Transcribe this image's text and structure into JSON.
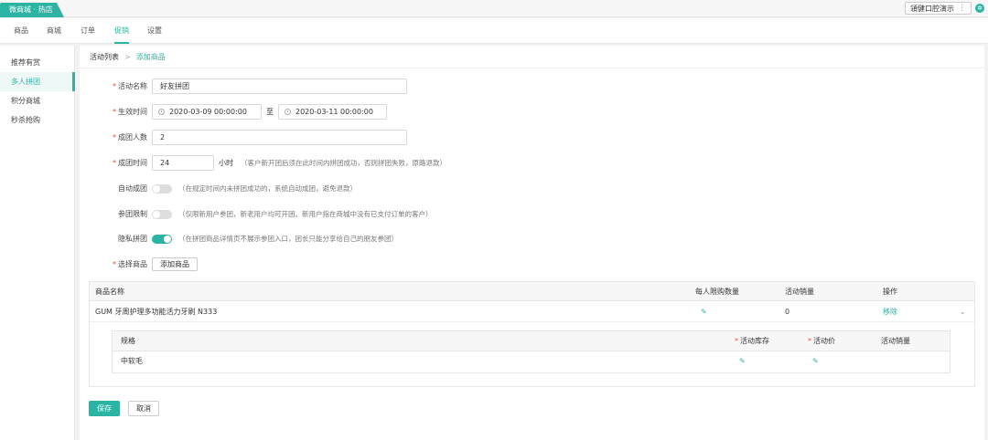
{
  "app": {
    "tab_title": "微商城 · 热店",
    "store_button": "領健口腔演示"
  },
  "nav": {
    "items": [
      "商品",
      "商城",
      "订单",
      "促销",
      "设置"
    ],
    "active": "促销"
  },
  "sidebar": {
    "items": [
      "推荐有赏",
      "多人拼团",
      "积分商城",
      "秒杀抢购"
    ],
    "active": "多人拼团"
  },
  "breadcrumb": {
    "parent": "活动列表",
    "separator": ">",
    "current": "添加商品"
  },
  "form": {
    "name": {
      "label": "活动名称",
      "value": "好友拼团"
    },
    "effective": {
      "label": "生效时间",
      "start": "2020-03-09 00:00:00",
      "to": "至",
      "end": "2020-03-11 00:00:00"
    },
    "group_size": {
      "label": "成团人数",
      "value": "2"
    },
    "group_time": {
      "label": "成团时间",
      "value": "24",
      "unit": "小时",
      "hint": "（客户新开团后须在此时间内拼团成功，否则拼团失败，原路退款）"
    },
    "auto_group": {
      "label": "自动成团",
      "on": false,
      "hint": "（在规定时间内未拼团成功的，系统自动成团，避免退款）"
    },
    "limit": {
      "label": "参团限制",
      "on": false,
      "hint": "（仅限新用户参团，新老用户均可开团。新用户指在商城中没有已支付订单的客户）"
    },
    "private": {
      "label": "隐私拼团",
      "on": true,
      "hint": "（在拼团商品详情页不展示参团入口，团长只能分享给自己的朋友参团）"
    },
    "select_goods": {
      "label": "选择商品",
      "button": "添加商品"
    }
  },
  "goods_table": {
    "headers": {
      "name": "商品名称",
      "limit": "每人限购数量",
      "sales": "活动销量",
      "op": "操作"
    },
    "rows": [
      {
        "name": "GUM 牙周护理多功能活力牙刷 N333",
        "sales": "0",
        "op": "移除"
      }
    ],
    "sub_headers": {
      "spec": "规格",
      "stock": "活动库存",
      "price": "活动价",
      "sales": "活动销量"
    },
    "sub_rows": [
      {
        "spec": "中软毛"
      }
    ]
  },
  "actions": {
    "save": "保存",
    "cancel": "取消"
  },
  "colors": {
    "accent": "#2bb3a3",
    "required": "#e74c3c"
  }
}
